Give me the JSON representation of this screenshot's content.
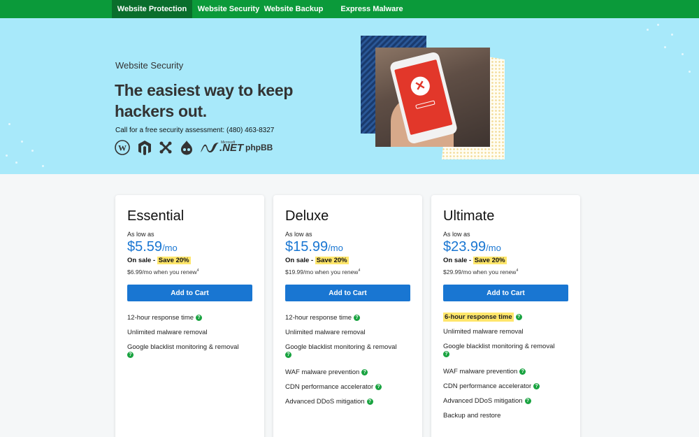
{
  "nav": {
    "tabs": [
      "Website Protection",
      "Website Security",
      "Website Backup",
      "Express Malware Removal"
    ],
    "active": "Website Security"
  },
  "hero": {
    "eyebrow": "Website Security",
    "title": "The easiest way to keep hackers out.",
    "phone_text": "Call for a free security assessment: (480) 463-8327",
    "platforms": [
      "wordpress-icon",
      "magento-icon",
      "joomla-icon",
      "drupal-icon",
      "Microsoft .NET",
      "phpBB"
    ],
    "platform_net_label": ".NET",
    "platform_net_small": "Microsoft",
    "platform_phpbb_label": "phpBB"
  },
  "plans": [
    {
      "name": "Essential",
      "as_low_as": "As low as",
      "price": "$5.59",
      "per": "/mo",
      "sale_prefix": "On sale - ",
      "sale_badge": "Save 20%",
      "renew": "$6.99/mo when you renew",
      "renew_note": "4",
      "cta": "Add to Cart",
      "features": [
        {
          "text": "12-hour response time",
          "help": true
        },
        {
          "text": "Unlimited malware removal",
          "help": false
        },
        {
          "text": "Google blacklist monitoring & removal",
          "help": true,
          "help_newline": true
        }
      ]
    },
    {
      "name": "Deluxe",
      "as_low_as": "As low as",
      "price": "$15.99",
      "per": "/mo",
      "sale_prefix": "On sale - ",
      "sale_badge": "Save 20%",
      "renew": "$19.99/mo when you renew",
      "renew_note": "4",
      "cta": "Add to Cart",
      "features": [
        {
          "text": "12-hour response time",
          "help": true
        },
        {
          "text": "Unlimited malware removal",
          "help": false
        },
        {
          "text": "Google blacklist monitoring & removal",
          "help": true,
          "help_newline": true
        },
        {
          "text": "WAF malware prevention",
          "help": true
        },
        {
          "text": "CDN performance accelerator",
          "help": true
        },
        {
          "text": "Advanced DDoS mitigation",
          "help": true
        }
      ]
    },
    {
      "name": "Ultimate",
      "as_low_as": "As low as",
      "price": "$23.99",
      "per": "/mo",
      "sale_prefix": "On sale - ",
      "sale_badge": "Save 20%",
      "renew": "$29.99/mo when you renew",
      "renew_note": "4",
      "cta": "Add to Cart",
      "features": [
        {
          "text": "6-hour response time",
          "help": true,
          "highlight": true
        },
        {
          "text": "Unlimited malware removal",
          "help": false
        },
        {
          "text": "Google blacklist monitoring & removal",
          "help": true,
          "help_newline": true
        },
        {
          "text": "WAF malware prevention",
          "help": true
        },
        {
          "text": "CDN performance accelerator",
          "help": true
        },
        {
          "text": "Advanced DDoS mitigation",
          "help": true
        },
        {
          "text": "Backup and restore",
          "help": false
        }
      ]
    }
  ],
  "colors": {
    "nav_green": "#0b9a3a",
    "nav_active": "#0a6e2c",
    "hero_bg": "#a8e9fa",
    "price_blue": "#1976d2",
    "highlight": "#ffe66b",
    "help_green": "#19a340"
  },
  "help_glyph": "?"
}
